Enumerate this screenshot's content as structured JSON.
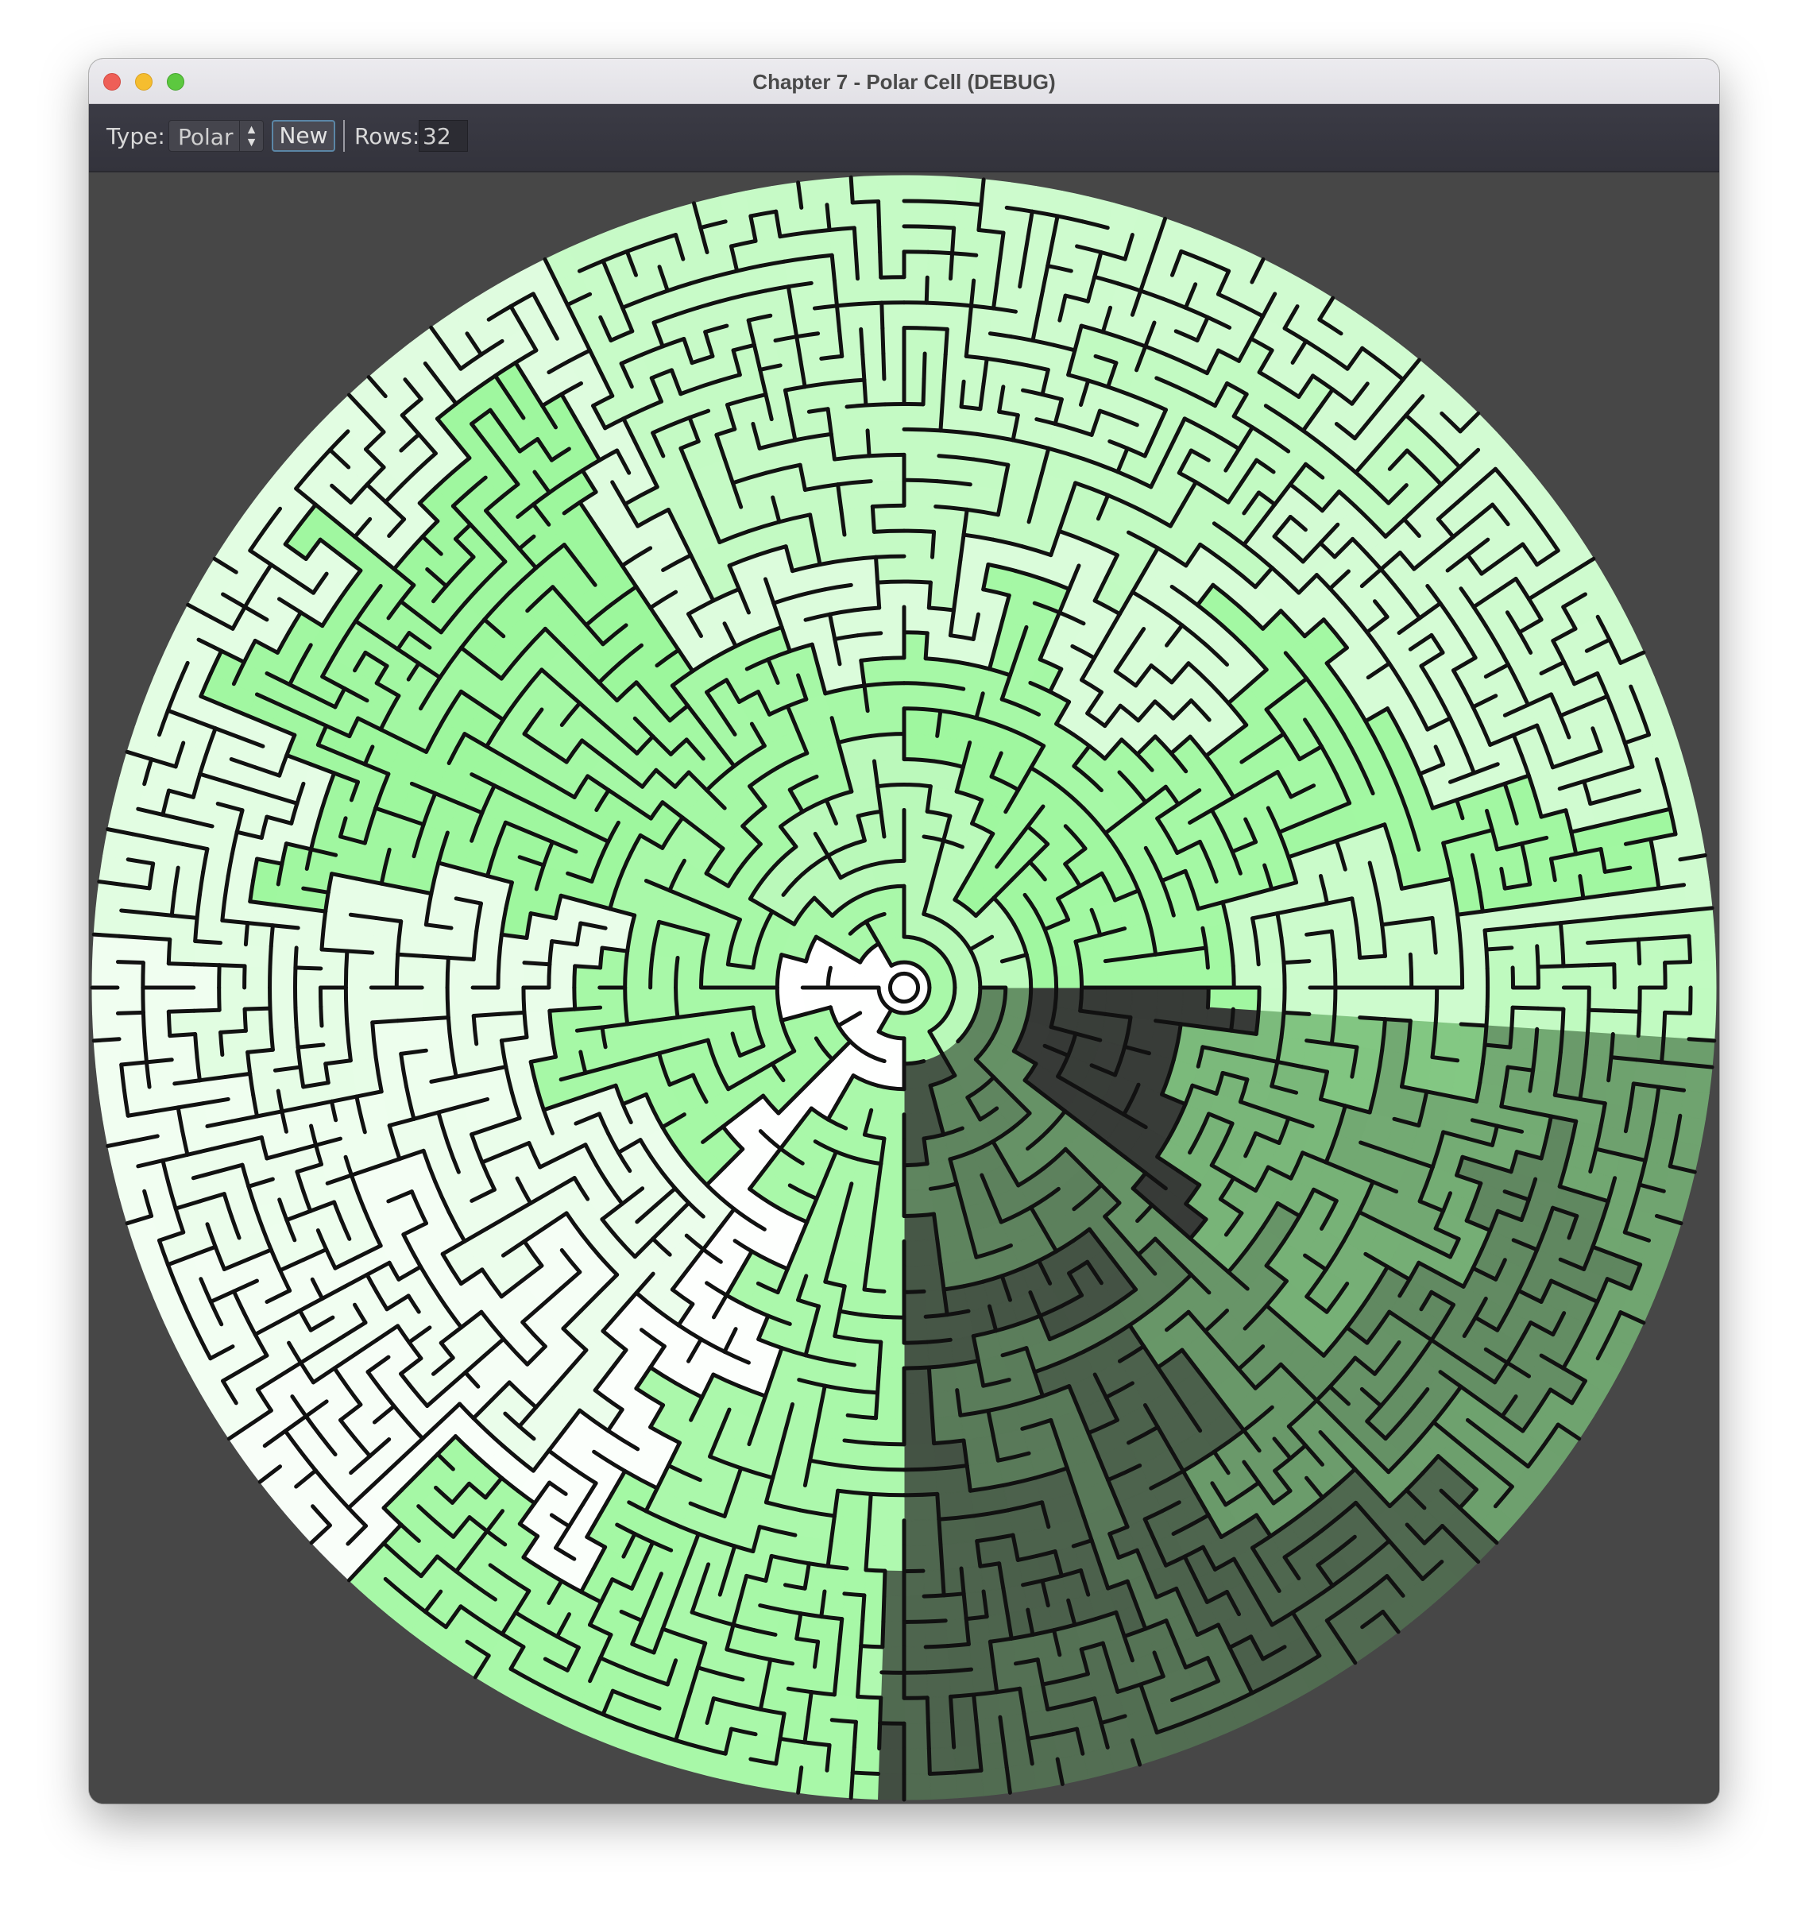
{
  "window": {
    "title": "Chapter 7 - Polar Cell (DEBUG)"
  },
  "toolbar": {
    "type_label": "Type:",
    "type_value": "Polar",
    "new_label": "New",
    "rows_label": "Rows:",
    "rows_value": "32"
  },
  "maze": {
    "kind": "polar",
    "rows": 32,
    "color_far": "#9cf79c",
    "color_near": "#ffffff",
    "color_dark": "#333333",
    "wall_color": "#111111",
    "background": "#474747"
  }
}
